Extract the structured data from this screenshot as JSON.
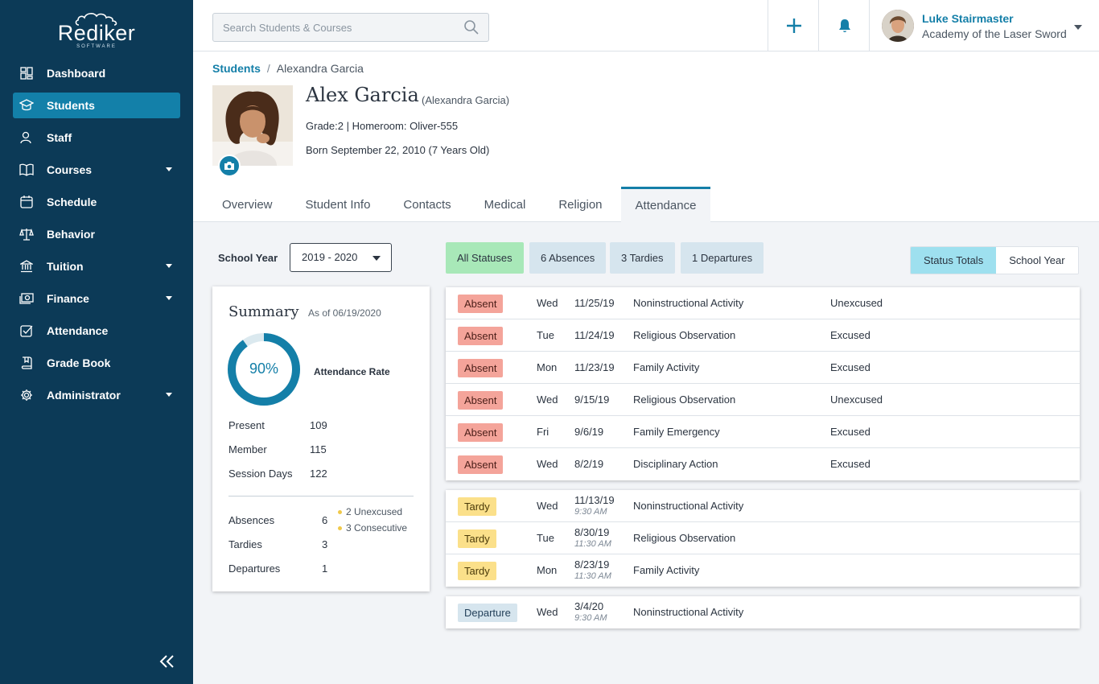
{
  "app": {
    "logo_word": "Rediker",
    "logo_sub": "SOFTWARE"
  },
  "sidebar": {
    "items": [
      {
        "label": "Dashboard",
        "icon": "dashboard-icon",
        "active": false,
        "has_caret": false
      },
      {
        "label": "Students",
        "icon": "students-icon",
        "active": true,
        "has_caret": false
      },
      {
        "label": "Staff",
        "icon": "staff-icon",
        "active": false,
        "has_caret": false
      },
      {
        "label": "Courses",
        "icon": "book-icon",
        "active": false,
        "has_caret": true
      },
      {
        "label": "Schedule",
        "icon": "calendar-icon",
        "active": false,
        "has_caret": false
      },
      {
        "label": "Behavior",
        "icon": "scale-icon",
        "active": false,
        "has_caret": false
      },
      {
        "label": "Tuition",
        "icon": "bank-icon",
        "active": false,
        "has_caret": true
      },
      {
        "label": "Finance",
        "icon": "money-icon",
        "active": false,
        "has_caret": true
      },
      {
        "label": "Attendance",
        "icon": "checkbox-icon",
        "active": false,
        "has_caret": false
      },
      {
        "label": "Grade Book",
        "icon": "gradebook-icon",
        "active": false,
        "has_caret": false
      },
      {
        "label": "Administrator",
        "icon": "gear-icon",
        "active": false,
        "has_caret": true
      }
    ]
  },
  "topbar": {
    "search_placeholder": "Search Students & Courses",
    "user_name": "Luke Stairmaster",
    "user_org": "Academy of the Laser Sword"
  },
  "breadcrumb": {
    "root": "Students",
    "current": "Alexandra Garcia"
  },
  "student": {
    "name": "Alex Garcia",
    "legal_name": "(Alexandra Garcia)",
    "grade_line": "Grade:2 | Homeroom: Oliver-555",
    "born_line": "Born September 22, 2010 (7 Years Old)"
  },
  "tabs": [
    "Overview",
    "Student Info",
    "Contacts",
    "Medical",
    "Religion",
    "Attendance"
  ],
  "active_tab": "Attendance",
  "school_year": {
    "label": "School Year",
    "value": "2019 - 2020"
  },
  "summary": {
    "title": "Summary",
    "as_of": "As of 06/19/2020",
    "rate_text": "90%",
    "rate_value": 0.9,
    "rate_label": "Attendance Rate",
    "stats": [
      {
        "label": "Present",
        "value": "109"
      },
      {
        "label": "Member",
        "value": "115"
      },
      {
        "label": "Session Days",
        "value": "122"
      }
    ],
    "counts": [
      {
        "label": "Absences",
        "value": "6"
      },
      {
        "label": "Tardies",
        "value": "3"
      },
      {
        "label": "Departures",
        "value": "1"
      }
    ],
    "notes": [
      "2 Unexcused",
      "3 Consecutive"
    ]
  },
  "filters": [
    "All Statuses",
    "6 Absences",
    "3 Tardies",
    "1 Departures"
  ],
  "view_toggle": {
    "options": [
      "Status Totals",
      "School Year"
    ],
    "selected": "Status Totals"
  },
  "records": {
    "absences": [
      {
        "status": "Absent",
        "day": "Wed",
        "date": "11/25/19",
        "reason": "Noninstructional Activity",
        "excuse": "Unexcused"
      },
      {
        "status": "Absent",
        "day": "Tue",
        "date": "11/24/19",
        "reason": "Religious Observation",
        "excuse": "Excused"
      },
      {
        "status": "Absent",
        "day": "Mon",
        "date": "11/23/19",
        "reason": "Family Activity",
        "excuse": "Excused"
      },
      {
        "status": "Absent",
        "day": "Wed",
        "date": "9/15/19",
        "reason": "Religious Observation",
        "excuse": "Unexcused"
      },
      {
        "status": "Absent",
        "day": "Fri",
        "date": "9/6/19",
        "reason": "Family Emergency",
        "excuse": "Excused"
      },
      {
        "status": "Absent",
        "day": "Wed",
        "date": "8/2/19",
        "reason": "Disciplinary Action",
        "excuse": "Excused"
      }
    ],
    "tardies": [
      {
        "status": "Tardy",
        "day": "Wed",
        "date": "11/13/19",
        "time": "9:30 AM",
        "reason": "Noninstructional Activity"
      },
      {
        "status": "Tardy",
        "day": "Tue",
        "date": "8/30/19",
        "time": "11:30 AM",
        "reason": "Religious Observation"
      },
      {
        "status": "Tardy",
        "day": "Mon",
        "date": "8/23/19",
        "time": "11:30 AM",
        "reason": "Family Activity"
      }
    ],
    "departures": [
      {
        "status": "Departure",
        "day": "Wed",
        "date": "3/4/20",
        "time": "9:30 AM",
        "reason": "Noninstructional Activity"
      }
    ]
  },
  "colors": {
    "sidebar_bg": "#0c3a57",
    "accent": "#147fa8",
    "absent": "#f4a49a",
    "tardy": "#fbe08a",
    "departure": "#d6e5ee",
    "all_statuses": "#a8e8b8"
  }
}
